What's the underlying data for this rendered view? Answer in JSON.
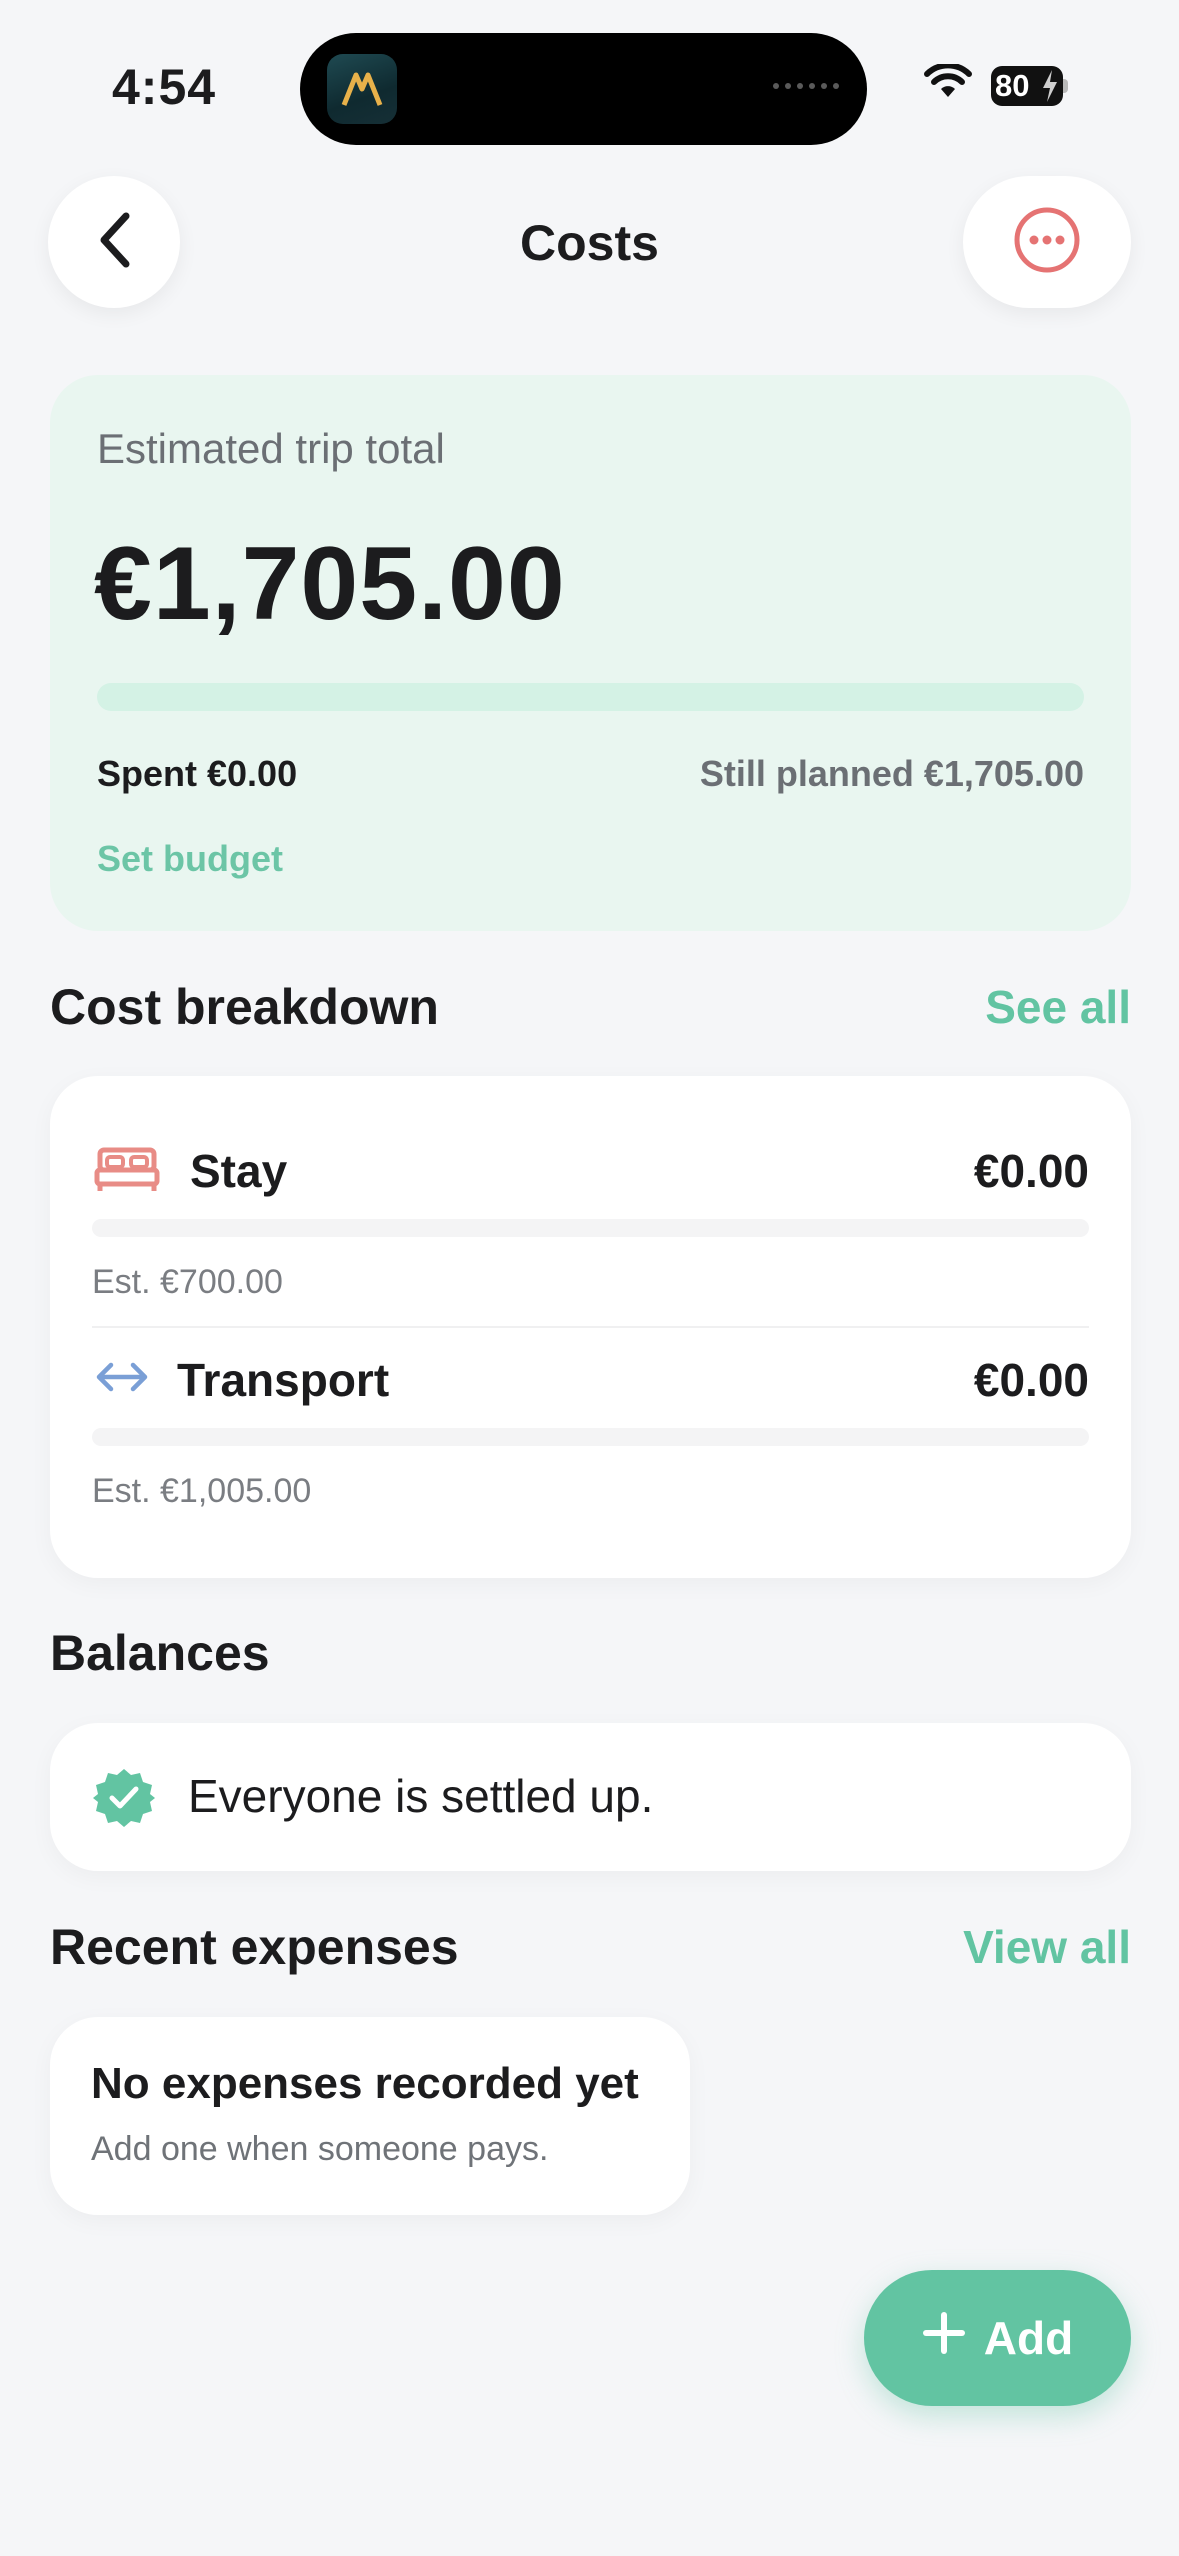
{
  "status_bar": {
    "time": "4:54",
    "battery": "80"
  },
  "nav": {
    "title": "Costs"
  },
  "summary": {
    "label": "Estimated trip total",
    "total": "€1,705.00",
    "spent": "Spent €0.00",
    "still_planned": "Still planned €1,705.00",
    "spent_fraction": 0.0,
    "set_budget": "Set budget"
  },
  "breakdown": {
    "title": "Cost breakdown",
    "see_all": "See all",
    "items": [
      {
        "name": "Stay",
        "amount": "€0.00",
        "estimate": "Est. €700.00",
        "icon": "bed-icon",
        "fill_fraction": 0.0
      },
      {
        "name": "Transport",
        "amount": "€0.00",
        "estimate": "Est. €1,005.00",
        "icon": "arrows-horizontal-icon",
        "fill_fraction": 0.0
      }
    ]
  },
  "balances": {
    "title": "Balances",
    "message": "Everyone is settled up."
  },
  "recent": {
    "title": "Recent expenses",
    "view_all": "View all",
    "empty_title": "No expenses recorded yet",
    "empty_subtitle": "Add one when someone pays."
  },
  "fab": {
    "label": "Add"
  },
  "colors": {
    "accent": "#62c4a2",
    "summary_bg": "#e9f6f0",
    "stay_icon": "#e88c86",
    "transport_icon": "#7a9fd6",
    "more_icon": "#e57373"
  }
}
